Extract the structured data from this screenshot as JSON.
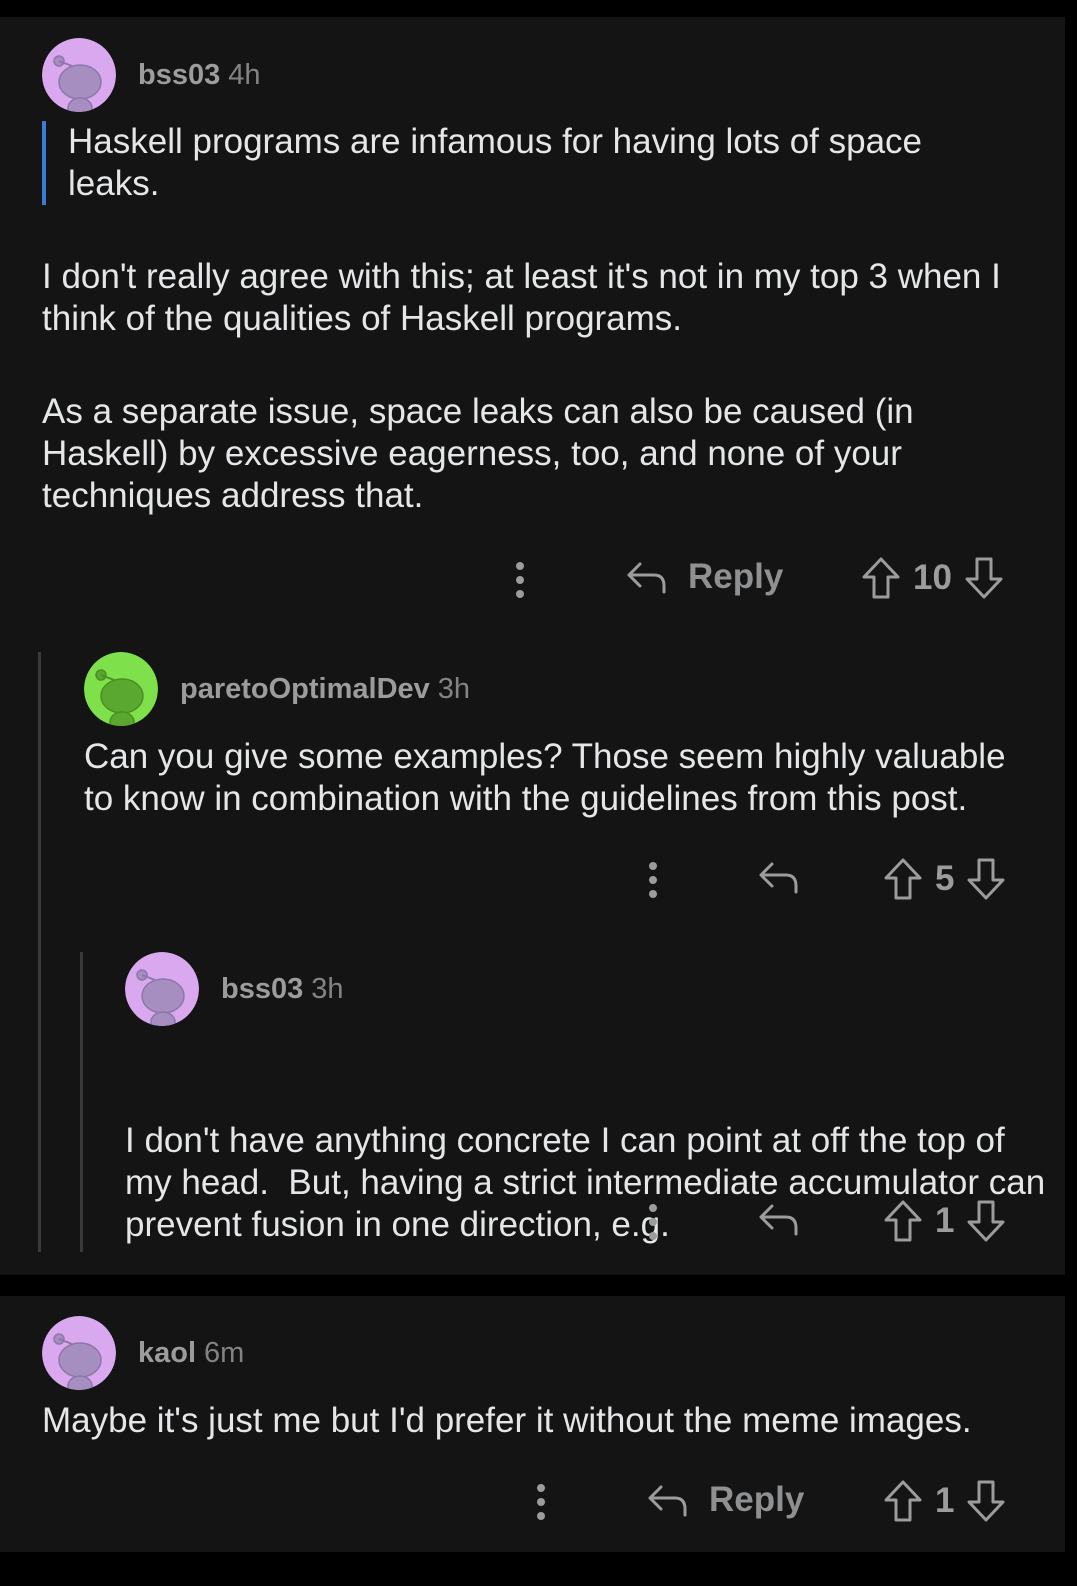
{
  "comments": [
    {
      "username": "bss03",
      "age": "4h",
      "avatar_color": "#d9a8ef",
      "quote": "Haskell programs are infamous for having lots of space leaks.",
      "paragraphs": [
        "I don't really agree with this; at least it's not in my top 3 when I think of the qualities of Haskell programs.",
        "As a separate issue, space leaks can also be caused (in Haskell) by excessive eagerness, too, and none of your techniques address that."
      ],
      "reply_label": "Reply",
      "score": "10"
    },
    {
      "username": "paretoOptimalDev",
      "age": "3h",
      "avatar_color": "#7ee04a",
      "paragraphs": [
        "Can you give some examples? Those seem highly valuable to know in combination with the guidelines from this post."
      ],
      "score": "5"
    },
    {
      "username": "bss03",
      "age": "3h",
      "avatar_color": "#d9a8ef",
      "paragraphs": [
        "I don't have anything concrete I can point at off the top of my head.  But, having a strict intermediate accumulator can prevent fusion in one direction, e.g."
      ],
      "score": "1"
    },
    {
      "username": "kaol",
      "age": "6m",
      "avatar_color": "#d9a8ef",
      "paragraphs": [
        "Maybe it's just me but I'd prefer it without the meme images."
      ],
      "reply_label": "Reply",
      "score": "1"
    }
  ],
  "icons": {
    "more": "more-vertical-icon",
    "reply": "reply-arrow-icon",
    "upvote": "upvote-arrow-icon",
    "downvote": "downvote-arrow-icon"
  }
}
